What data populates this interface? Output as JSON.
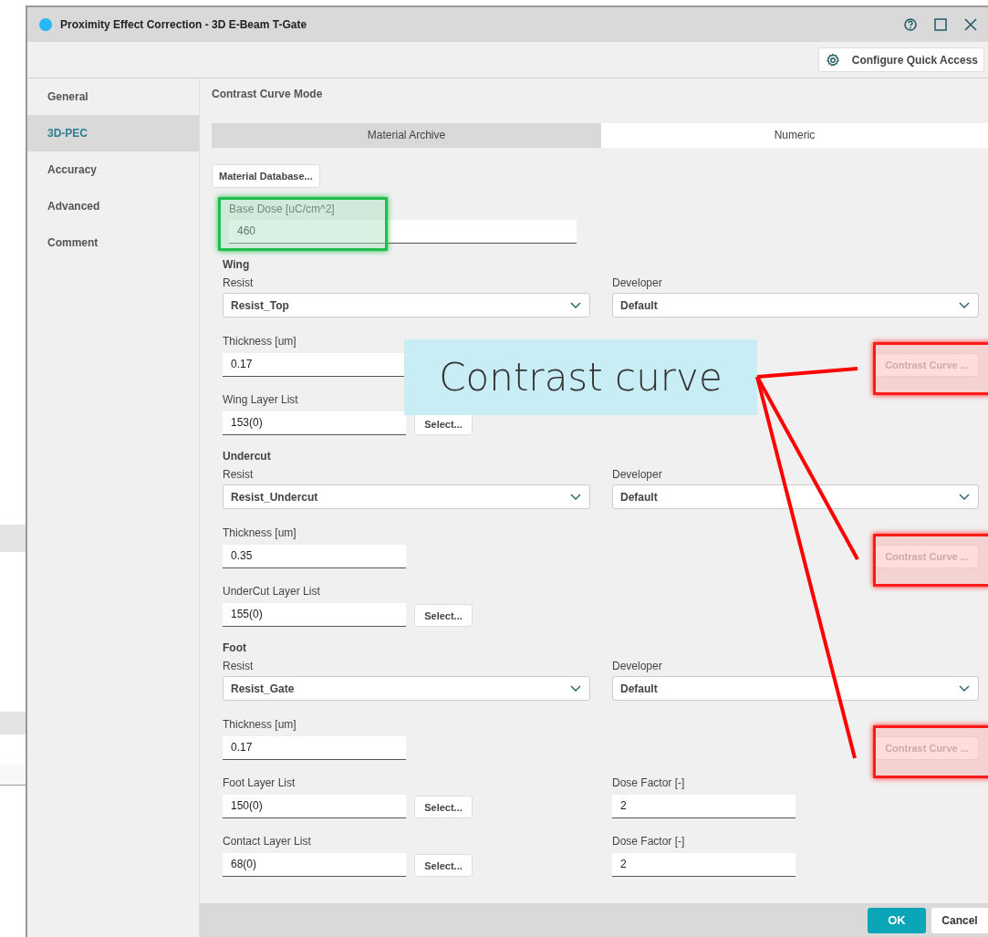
{
  "window": {
    "title": "Proximity Effect Correction - 3D E-Beam T-Gate"
  },
  "toolbar": {
    "button": "Configure Quick Access"
  },
  "sidebar": {
    "items": [
      {
        "label": "General",
        "selected": false
      },
      {
        "label": "3D-PEC",
        "selected": true
      },
      {
        "label": "Accuracy",
        "selected": false
      },
      {
        "label": "Advanced",
        "selected": false
      },
      {
        "label": "Comment",
        "selected": false
      }
    ]
  },
  "mode": {
    "label": "Contrast Curve Mode",
    "tabs": [
      {
        "label": "Material Archive",
        "selected": false
      },
      {
        "label": "Numeric",
        "selected": true
      }
    ]
  },
  "database_button": "Material Database...",
  "base_dose": {
    "label": "Base Dose [uC/cm^2]",
    "value": "460",
    "highlighted": true
  },
  "sections": [
    {
      "title": "Wing",
      "resist_label": "Resist",
      "resist": "Resist_Top",
      "developer_label": "Developer",
      "developer": "Default",
      "thickness_label": "Thickness [um]",
      "thickness": "0.17",
      "contrast_button": "Contrast Curve ...",
      "contrast_disabled": true,
      "contrast_highlighted": true,
      "layers": [
        {
          "label": "Wing Layer List",
          "value": "153(0)",
          "button": "Select..."
        }
      ]
    },
    {
      "title": "Undercut",
      "resist_label": "Resist",
      "resist": "Resist_Undercut",
      "developer_label": "Developer",
      "developer": "Default",
      "thickness_label": "Thickness [um]",
      "thickness": "0.35",
      "contrast_button": "Contrast Curve ...",
      "contrast_disabled": true,
      "contrast_highlighted": true,
      "layers": [
        {
          "label": "UnderCut Layer List",
          "value": "155(0)",
          "button": "Select..."
        }
      ]
    },
    {
      "title": "Foot",
      "resist_label": "Resist",
      "resist": "Resist_Gate",
      "developer_label": "Developer",
      "developer": "Default",
      "thickness_label": "Thickness [um]",
      "thickness": "0.17",
      "contrast_button": "Contrast Curve ...",
      "contrast_disabled": true,
      "contrast_highlighted": true,
      "layers": [
        {
          "label": "Foot Layer List",
          "value": "150(0)",
          "button": "Select...",
          "dose_label": "Dose Factor [-]",
          "dose": "2"
        },
        {
          "label": "Contact Layer List",
          "value": "68(0)",
          "button": "Select...",
          "dose_label": "Dose Factor [-]",
          "dose": "2"
        }
      ]
    }
  ],
  "footer": {
    "ok": "OK",
    "cancel": "Cancel"
  },
  "callout": {
    "text": "Contrast curve"
  }
}
